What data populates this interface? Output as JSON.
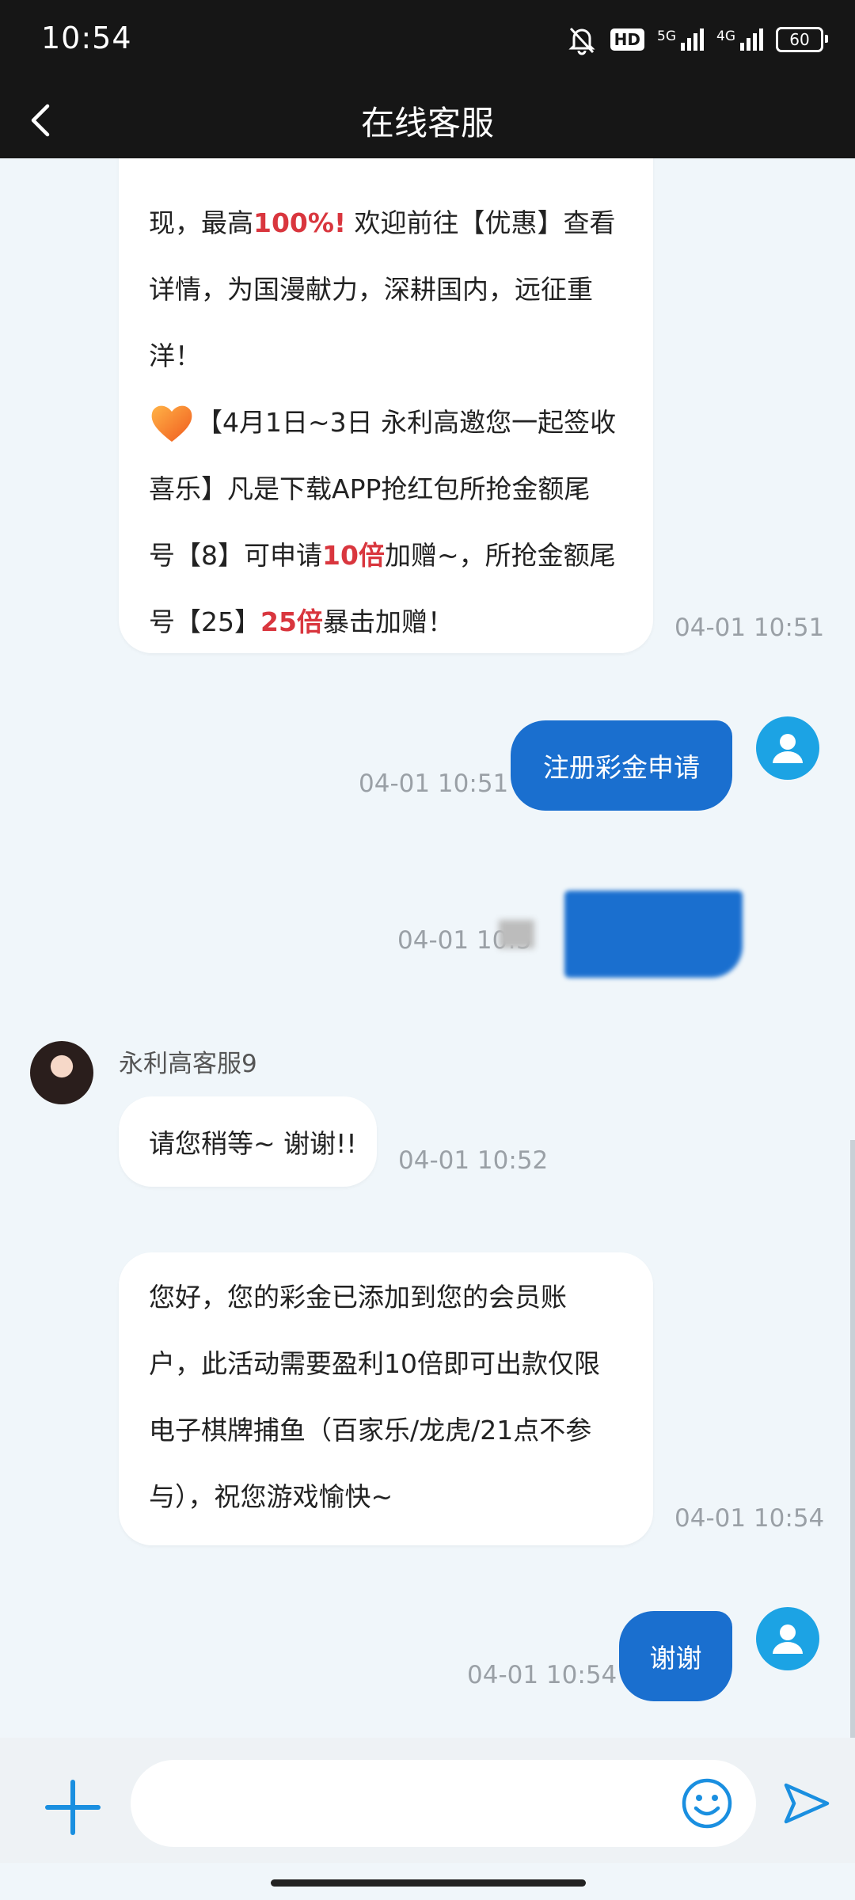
{
  "status_bar": {
    "time": "10:54",
    "hd": "HD",
    "net1": "5G",
    "net2": "4G",
    "battery": "60"
  },
  "nav": {
    "title": "在线客服"
  },
  "messages": {
    "m1": {
      "line1_a": "现，最高",
      "line1_red": "100%!",
      "line1_b": " 欢迎前往【优惠】查看",
      "line2": "详情，为国漫献力，深耕国内，远征重",
      "line3": "洋！",
      "line4": "【4月1日~3日 永利高邀您一起签收",
      "line5": "喜乐】凡是下载APP抢红包所抢金额尾",
      "line6_a": "号【8】可申请",
      "line6_red": "10倍",
      "line6_b": "加赠~，所抢金额尾",
      "line7_a": "号【25】",
      "line7_red": "25倍",
      "line7_b": "暴击加赠！",
      "time": "04-01 10:51"
    },
    "m2": {
      "text": "注册彩金申请",
      "time": "04-01 10:51"
    },
    "m3": {
      "time": "04-01 10:5"
    },
    "agent_name": "永利高客服9",
    "m4": {
      "text": "请您稍等~ 谢谢!!",
      "time": "04-01 10:52"
    },
    "m5": {
      "line1": "您好，您的彩金已添加到您的会员账",
      "line2": "户，此活动需要盈利10倍即可出款仅限",
      "line3": "电子棋牌捕鱼（百家乐/龙虎/21点不参",
      "line4": "与），祝您游戏愉快~",
      "time": "04-01 10:54"
    },
    "m6": {
      "text": "谢谢",
      "time": "04-01 10:54"
    }
  },
  "input": {
    "placeholder": ""
  },
  "colors": {
    "accent": "#1a6fcf",
    "highlight": "#d9363e",
    "user_avatar": "#1ca3e4"
  }
}
